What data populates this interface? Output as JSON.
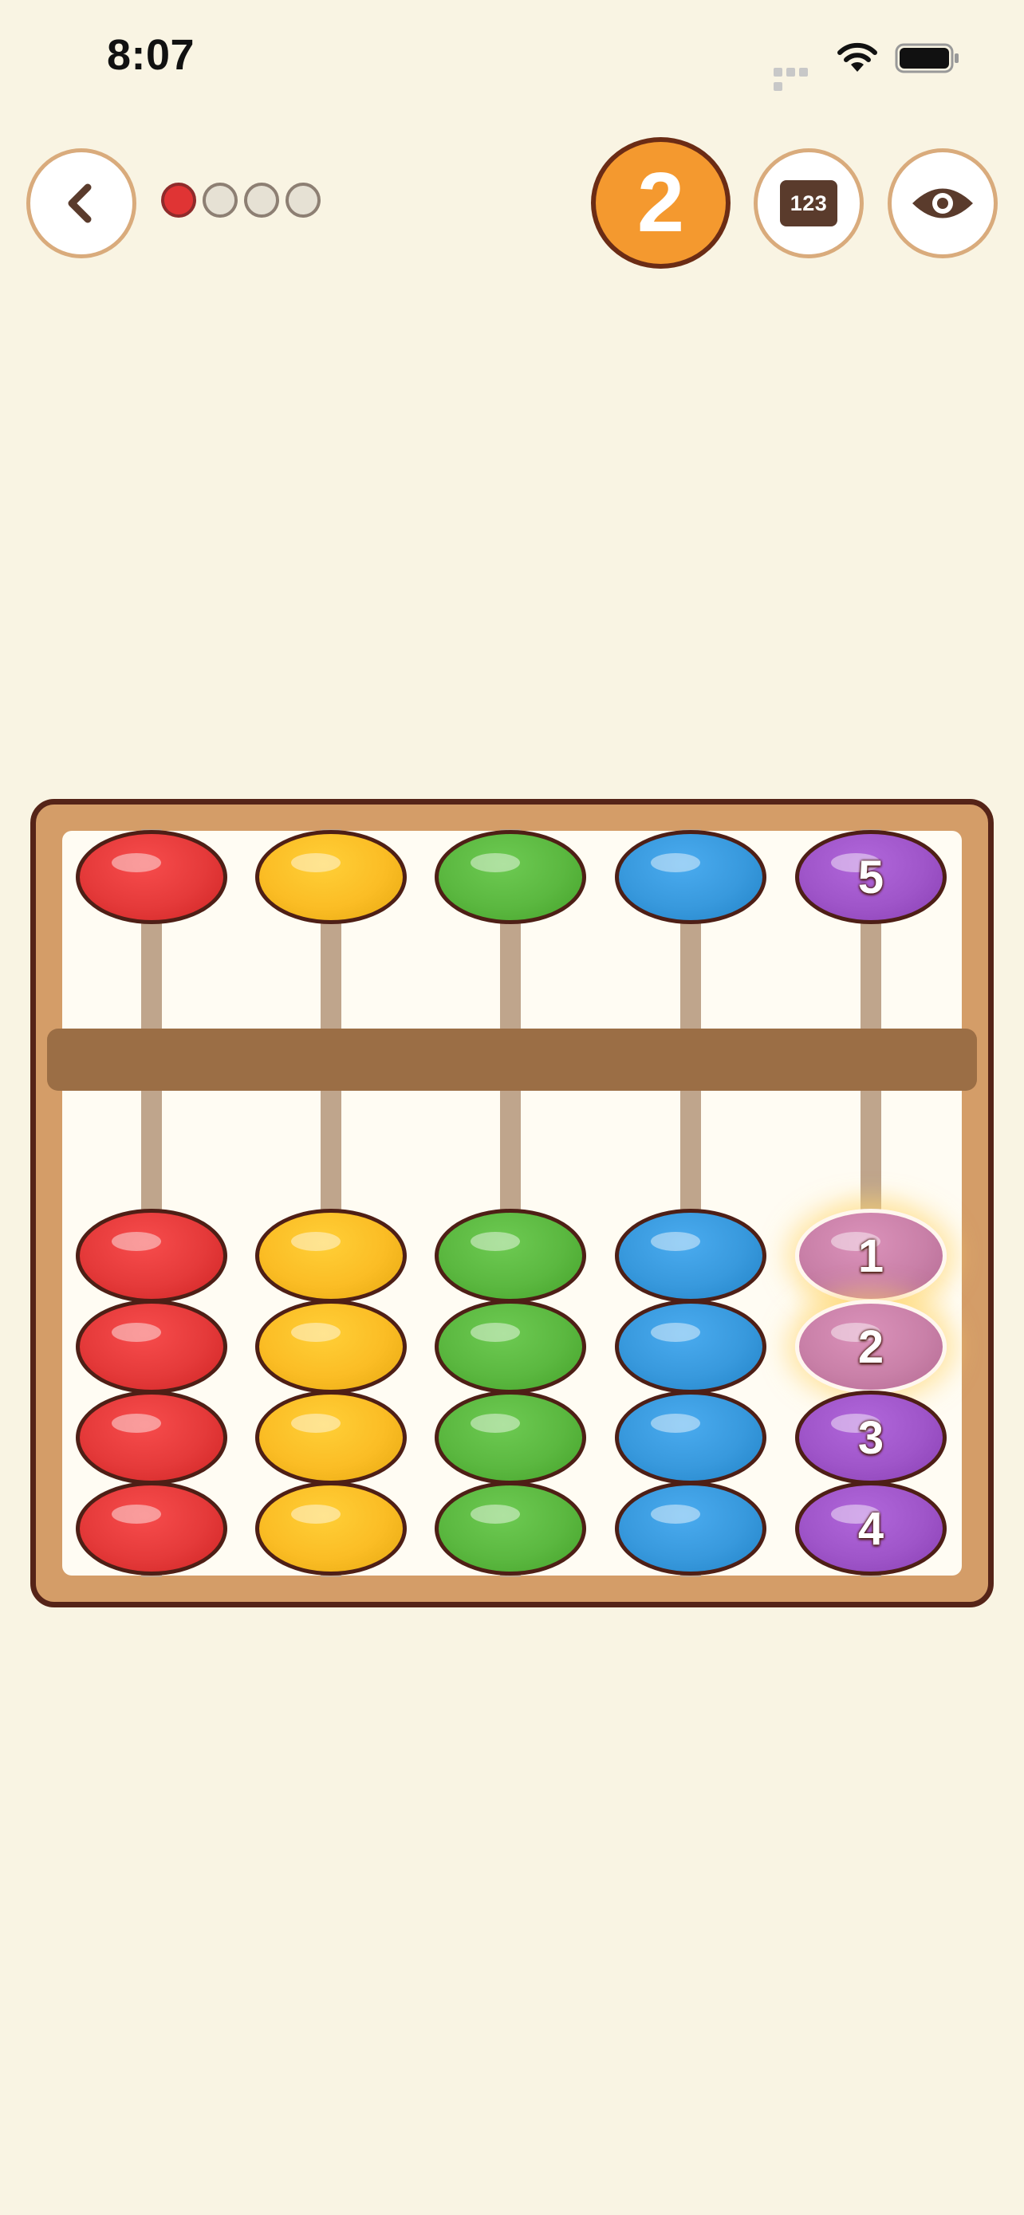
{
  "status_bar": {
    "time": "8:07"
  },
  "top_bar": {
    "progress": {
      "total": 4,
      "completed": 1
    },
    "level": "2",
    "numbers_button_label": "123"
  },
  "abacus": {
    "columns": [
      {
        "color": "#e53a3a",
        "upper_label": "",
        "lower_labels": [
          "",
          "",
          "",
          ""
        ]
      },
      {
        "color": "#fbbd25",
        "upper_label": "",
        "lower_labels": [
          "",
          "",
          "",
          ""
        ]
      },
      {
        "color": "#5bb840",
        "upper_label": "",
        "lower_labels": [
          "",
          "",
          "",
          ""
        ]
      },
      {
        "color": "#3899dd",
        "upper_label": "",
        "lower_labels": [
          "",
          "",
          "",
          ""
        ]
      },
      {
        "color": "#9f55c9",
        "upper_label": "5",
        "lower_labels": [
          "1",
          "2",
          "3",
          "4"
        ]
      }
    ],
    "highlighted_beads": [
      "column-5-lower-1",
      "column-5-lower-2"
    ],
    "highlight_color": "#c980a8"
  }
}
